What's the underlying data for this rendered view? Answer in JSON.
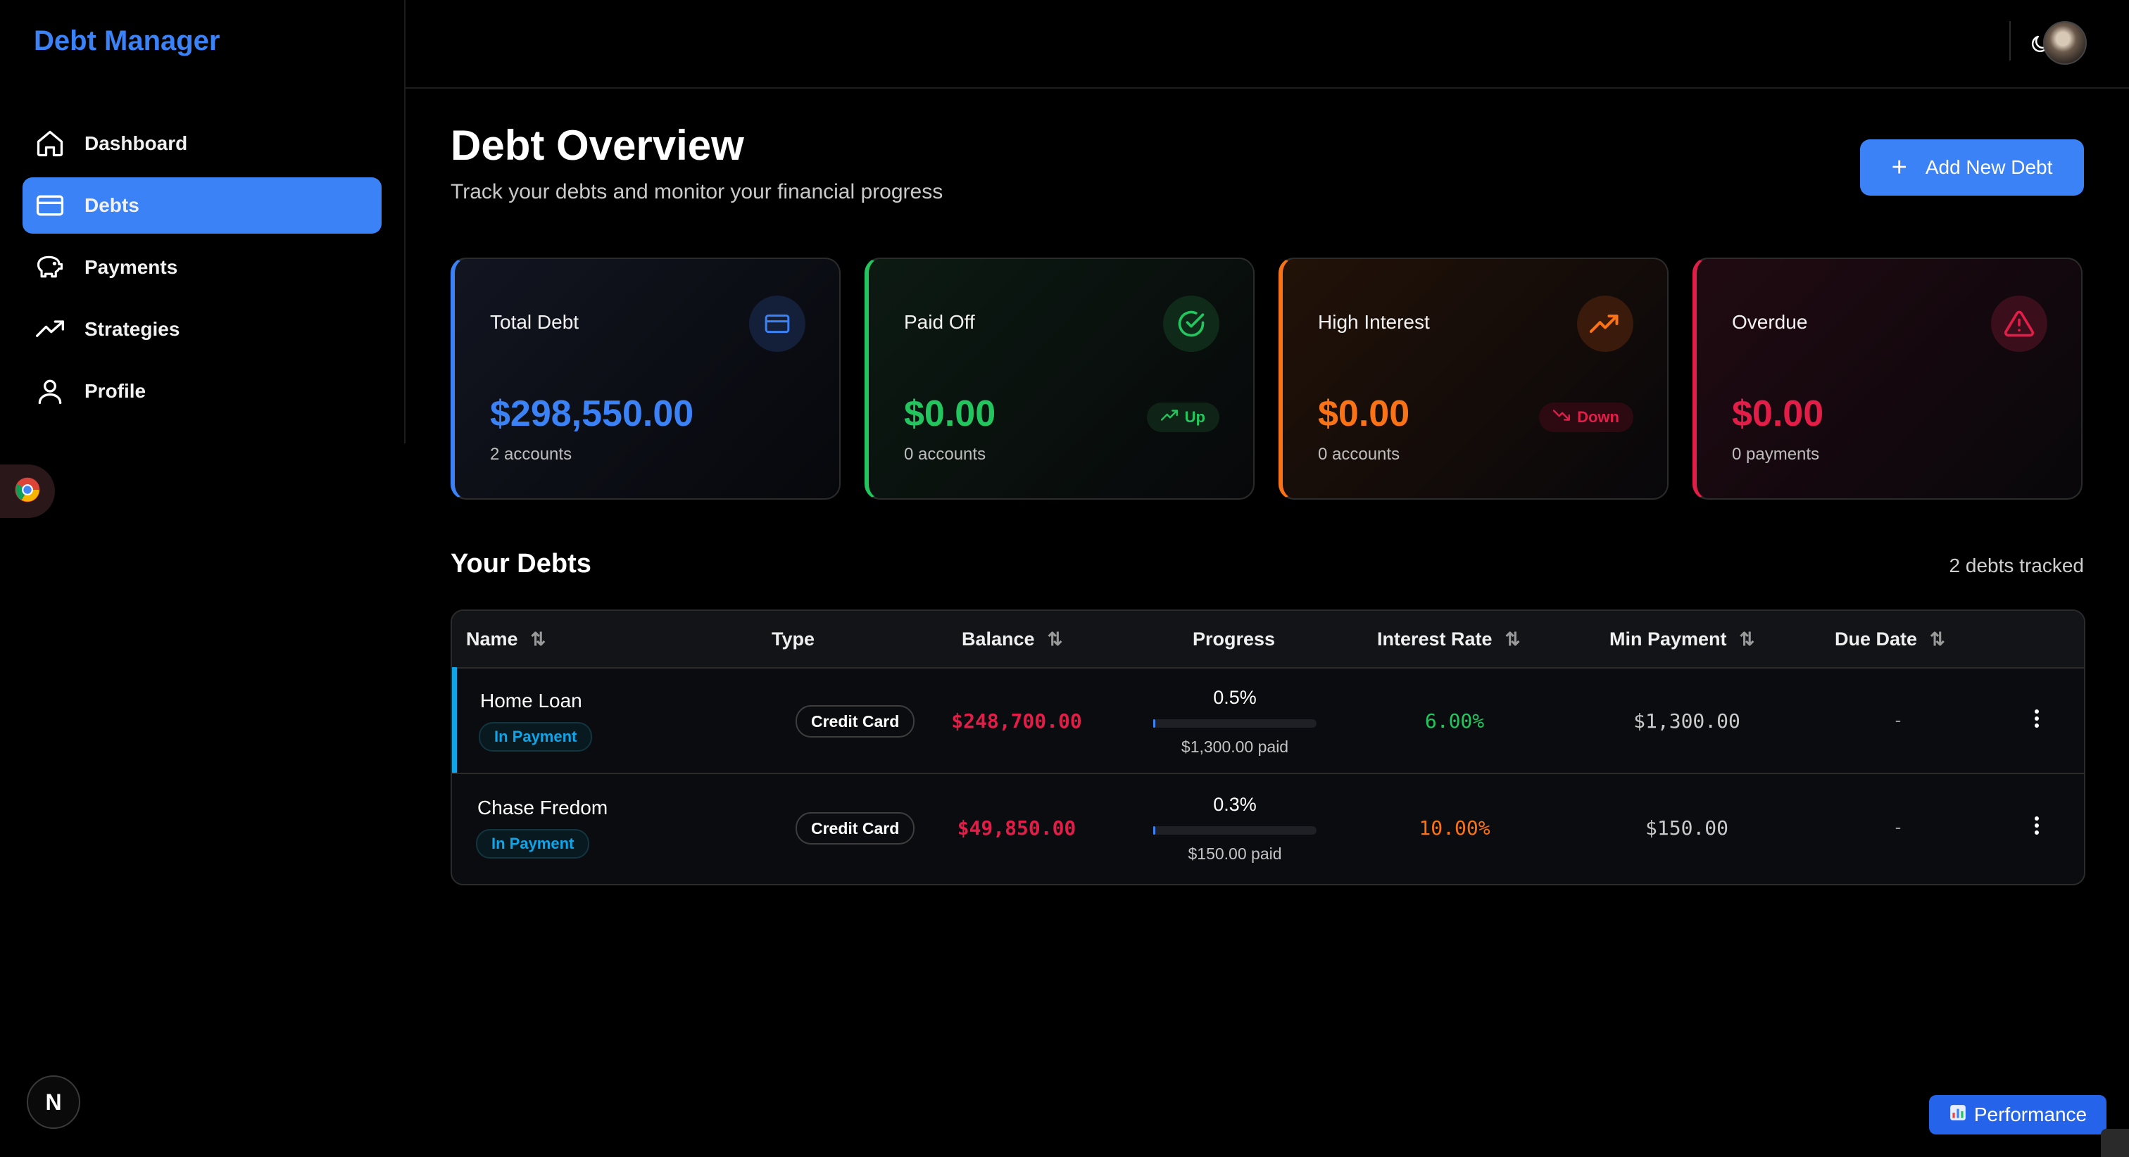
{
  "app": {
    "title": "Debt Manager"
  },
  "sidebar": {
    "items": [
      {
        "label": "Dashboard",
        "icon": "home-icon",
        "active": false
      },
      {
        "label": "Debts",
        "icon": "credit-card-icon",
        "active": true
      },
      {
        "label": "Payments",
        "icon": "piggy-bank-icon",
        "active": false
      },
      {
        "label": "Strategies",
        "icon": "trending-up-icon",
        "active": false
      },
      {
        "label": "Profile",
        "icon": "user-icon",
        "active": false
      }
    ]
  },
  "header": {
    "theme_icon": "moon-icon",
    "avatar": "avatar"
  },
  "page": {
    "title": "Debt Overview",
    "subtitle": "Track your debts and monitor your financial progress",
    "add_button": "Add New Debt"
  },
  "stats": [
    {
      "title": "Total Debt",
      "value": "$298,550.00",
      "sub": "2 accounts",
      "icon": "credit-card-icon",
      "color": "#3b82f6"
    },
    {
      "title": "Paid Off",
      "value": "$0.00",
      "sub": "0 accounts",
      "icon": "check-circle-icon",
      "color": "#22c55e",
      "trend": "Up"
    },
    {
      "title": "High Interest",
      "value": "$0.00",
      "sub": "0 accounts",
      "icon": "trending-up-icon",
      "color": "#f97316",
      "trend": "Down"
    },
    {
      "title": "Overdue",
      "value": "$0.00",
      "sub": "0 payments",
      "icon": "alert-triangle-icon",
      "color": "#e11d48"
    }
  ],
  "debts": {
    "title": "Your Debts",
    "count": "2 debts tracked",
    "columns": [
      "Name",
      "Type",
      "Balance",
      "Progress",
      "Interest Rate",
      "Min Payment",
      "Due Date"
    ],
    "rows": [
      {
        "name": "Home Loan",
        "status": "In Payment",
        "type": "Credit Card",
        "balance": "$248,700.00",
        "progress": "0.5%",
        "progress_value": 0.005,
        "paid": "$1,300.00 paid",
        "rate": "6.00%",
        "rate_color": "#22c55e",
        "min_payment": "$1,300.00",
        "due": "-"
      },
      {
        "name": "Chase Fredom",
        "status": "In Payment",
        "type": "Credit Card",
        "balance": "$49,850.00",
        "progress": "0.3%",
        "progress_value": 0.003,
        "paid": "$150.00 paid",
        "rate": "10.00%",
        "rate_color": "#f97316",
        "min_payment": "$150.00",
        "due": "-"
      }
    ]
  },
  "performance": {
    "label": "Performance"
  },
  "next_badge": "N"
}
